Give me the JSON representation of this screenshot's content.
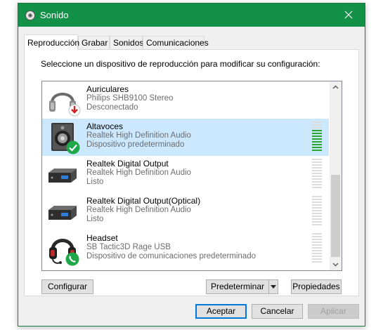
{
  "window": {
    "title": "Sonido",
    "titlebar_color": "#149148"
  },
  "tabs": [
    {
      "label": "Reproducción",
      "active": true
    },
    {
      "label": "Grabar",
      "active": false
    },
    {
      "label": "Sonidos",
      "active": false
    },
    {
      "label": "Comunicaciones",
      "active": false
    }
  ],
  "instruction": "Seleccione un dispositivo de reproducción para modificar su configuración:",
  "devices": [
    {
      "name": "Auriculares",
      "description": "Philips SHB9100 Stereo",
      "status": "Desconectado",
      "icon": "headphones-icon",
      "badge": "disconnected-arrow-icon",
      "selected": false,
      "level": null
    },
    {
      "name": "Altavoces",
      "description": "Realtek High Definition Audio",
      "status": "Dispositivo predeterminado",
      "icon": "speaker-icon",
      "badge": "default-check-icon",
      "selected": true,
      "level": 0.75
    },
    {
      "name": "Realtek Digital Output",
      "description": "Realtek High Definition Audio",
      "status": "Listo",
      "icon": "digital-output-icon",
      "badge": null,
      "selected": false,
      "level": 0
    },
    {
      "name": "Realtek Digital Output(Optical)",
      "description": "Realtek High Definition Audio",
      "status": "Listo",
      "icon": "digital-output-icon",
      "badge": null,
      "selected": false,
      "level": 0
    },
    {
      "name": "Headset",
      "description": "SB Tactic3D Rage USB",
      "status": "Dispositivo de comunicaciones predeterminado",
      "icon": "headset-icon",
      "badge": "communications-phone-icon",
      "selected": false,
      "level": 0
    }
  ],
  "buttons": {
    "configure": "Configurar",
    "set_default": "Predeterminar",
    "properties": "Propiedades",
    "ok": "Aceptar",
    "cancel": "Cancelar",
    "apply": "Aplicar"
  },
  "colors": {
    "selection": "#cce8ff",
    "meter_active": "#2ba52b",
    "default_badge": "#1fa84a"
  }
}
